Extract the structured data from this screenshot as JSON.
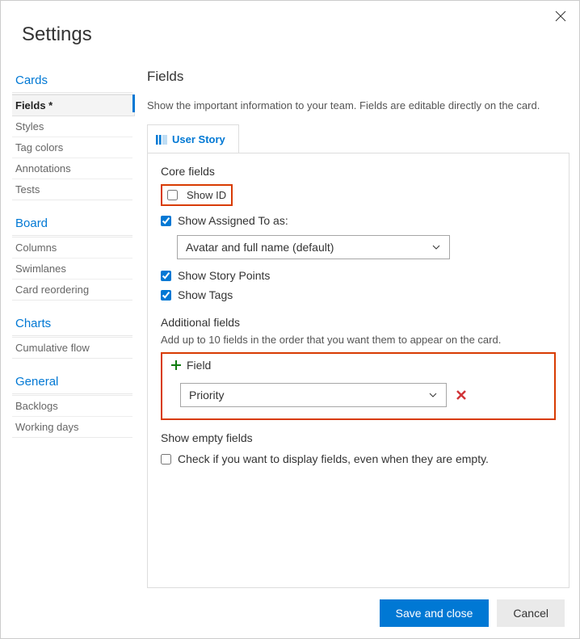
{
  "title": "Settings",
  "sidebar": {
    "sections": [
      {
        "head": "Cards",
        "items": [
          {
            "label": "Fields *",
            "selected": true
          },
          {
            "label": "Styles"
          },
          {
            "label": "Tag colors"
          },
          {
            "label": "Annotations"
          },
          {
            "label": "Tests"
          }
        ]
      },
      {
        "head": "Board",
        "items": [
          {
            "label": "Columns"
          },
          {
            "label": "Swimlanes"
          },
          {
            "label": "Card reordering"
          }
        ]
      },
      {
        "head": "Charts",
        "items": [
          {
            "label": "Cumulative flow"
          }
        ]
      },
      {
        "head": "General",
        "items": [
          {
            "label": "Backlogs"
          },
          {
            "label": "Working days"
          }
        ]
      }
    ]
  },
  "content": {
    "heading": "Fields",
    "description": "Show the important information to your team. Fields are editable directly on the card.",
    "tab": {
      "label": "User Story"
    },
    "core": {
      "heading": "Core fields",
      "show_id": {
        "label": "Show ID",
        "checked": false
      },
      "show_assigned": {
        "label": "Show Assigned To as:",
        "checked": true
      },
      "assigned_select": "Avatar and full name (default)",
      "show_story_points": {
        "label": "Show Story Points",
        "checked": true
      },
      "show_tags": {
        "label": "Show Tags",
        "checked": true
      }
    },
    "additional": {
      "heading": "Additional fields",
      "description": "Add up to 10 fields in the order that you want them to appear on the card.",
      "add_label": "Field",
      "field_value": "Priority"
    },
    "empty": {
      "heading": "Show empty fields",
      "label": "Check if you want to display fields, even when they are empty.",
      "checked": false
    }
  },
  "footer": {
    "save": "Save and close",
    "cancel": "Cancel"
  }
}
